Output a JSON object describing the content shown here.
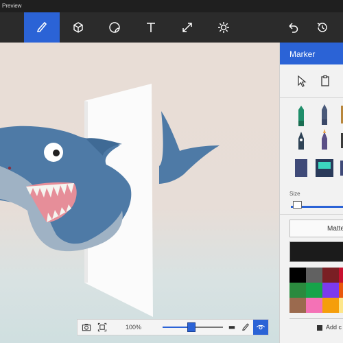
{
  "window": {
    "title": "Preview"
  },
  "toolbar": {
    "tools": [
      {
        "name": "brush-icon",
        "active": true
      },
      {
        "name": "3d-shapes-icon",
        "active": false
      },
      {
        "name": "stickers-icon",
        "active": false
      },
      {
        "name": "text-icon",
        "active": false
      },
      {
        "name": "canvas-icon",
        "active": false
      },
      {
        "name": "effects-icon",
        "active": false
      }
    ],
    "undo": "undo-icon",
    "history": "history-icon"
  },
  "panel": {
    "title": "Marker",
    "size_label": "Size",
    "size_value": 0.1,
    "matte_label": "Matte",
    "add_color_label": "Add c",
    "selected_color": "#1b1b1b",
    "palette": [
      "#000000",
      "#616161",
      "#7a1f24",
      "#c8102e",
      "#2b8a3e",
      "#16a34a",
      "#7c3aed",
      "#ea580c",
      "#9b6a4e",
      "#f472b6",
      "#f59e0b",
      "#fde68a"
    ]
  },
  "bottom_bar": {
    "zoom_text": "100%",
    "zoom_value": 0.45
  },
  "colors": {
    "accent": "#2b63d6",
    "toolbar": "#2b2b2b",
    "shark": "#4e7aa6"
  }
}
